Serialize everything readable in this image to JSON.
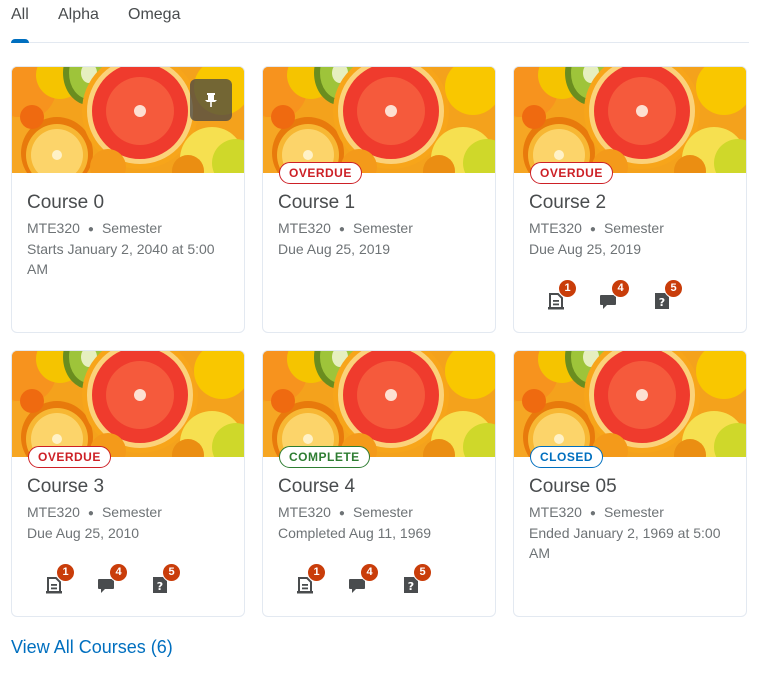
{
  "tabs": [
    {
      "label": "All",
      "active": true
    },
    {
      "label": "Alpha",
      "active": false
    },
    {
      "label": "Omega",
      "active": false
    }
  ],
  "courses": [
    {
      "title": "Course 0",
      "code": "MTE320",
      "term": "Semester",
      "status_text": "Starts January 2, 2040 at 5:00 AM",
      "pinned": true,
      "badge": null,
      "notifications": null
    },
    {
      "title": "Course 1",
      "code": "MTE320",
      "term": "Semester",
      "status_text": "Due Aug 25, 2019",
      "pinned": false,
      "badge": "OVERDUE",
      "notifications": null
    },
    {
      "title": "Course 2",
      "code": "MTE320",
      "term": "Semester",
      "status_text": "Due Aug 25, 2019",
      "pinned": false,
      "badge": "OVERDUE",
      "notifications": {
        "assignments": "1",
        "discussions": "4",
        "quizzes": "5"
      }
    },
    {
      "title": "Course 3",
      "code": "MTE320",
      "term": "Semester",
      "status_text": "Due Aug 25, 2010",
      "pinned": false,
      "badge": "OVERDUE",
      "notifications": {
        "assignments": "1",
        "discussions": "4",
        "quizzes": "5"
      }
    },
    {
      "title": "Course 4",
      "code": "MTE320",
      "term": "Semester",
      "status_text": "Completed Aug 11, 1969",
      "pinned": false,
      "badge": "COMPLETE",
      "notifications": {
        "assignments": "1",
        "discussions": "4",
        "quizzes": "5"
      }
    },
    {
      "title": "Course 05",
      "code": "MTE320",
      "term": "Semester",
      "status_text": "Ended January 2, 1969 at 5:00 AM",
      "pinned": false,
      "badge": "CLOSED",
      "notifications": null
    }
  ],
  "view_all_label": "View All Courses (6)",
  "colors": {
    "accent": "#006fbf",
    "overdue": "#cd2026",
    "complete": "#2e7d32",
    "notification": "#c93d0a"
  },
  "icons": {
    "pin": "pin-icon",
    "assignments": "assignments-icon",
    "discussions": "discussions-icon",
    "quizzes": "quizzes-icon"
  }
}
